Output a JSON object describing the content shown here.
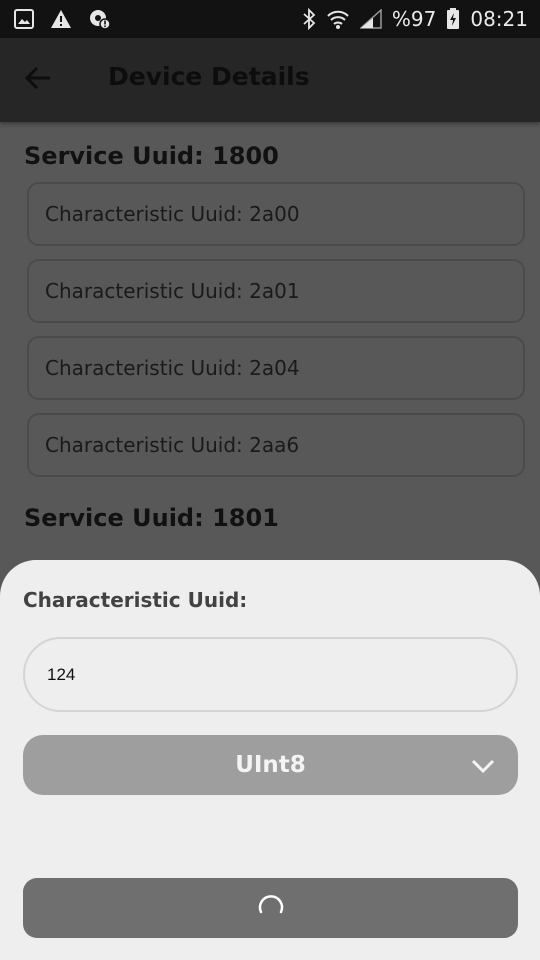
{
  "status_bar": {
    "battery": "%97",
    "time": "08:21",
    "icons": [
      "image-icon",
      "warning-icon",
      "settings-alert-icon",
      "bluetooth-icon",
      "wifi-icon",
      "signal-icon",
      "battery-charging-icon"
    ]
  },
  "app_bar": {
    "title": "Device Details",
    "back_icon": "arrow-back-icon"
  },
  "services": [
    {
      "title": "Service Uuid: 1800",
      "characteristics": [
        "Characteristic Uuid: 2a00",
        "Characteristic Uuid: 2a01",
        "Characteristic Uuid: 2a04",
        "Characteristic Uuid: 2aa6"
      ]
    },
    {
      "title": "Service Uuid: 1801",
      "characteristics": []
    }
  ],
  "sheet": {
    "label": "Characteristic Uuid:",
    "input_value": "124",
    "type_selected": "UInt8",
    "submit_state_icon": "loading-spinner-icon"
  },
  "colors": {
    "scrim_background": "#585858",
    "status_bar": "#121212",
    "app_bar": "#262626",
    "sheet": "#eeeeee",
    "select": "#9e9e9e",
    "button": "#6f6f6f"
  }
}
